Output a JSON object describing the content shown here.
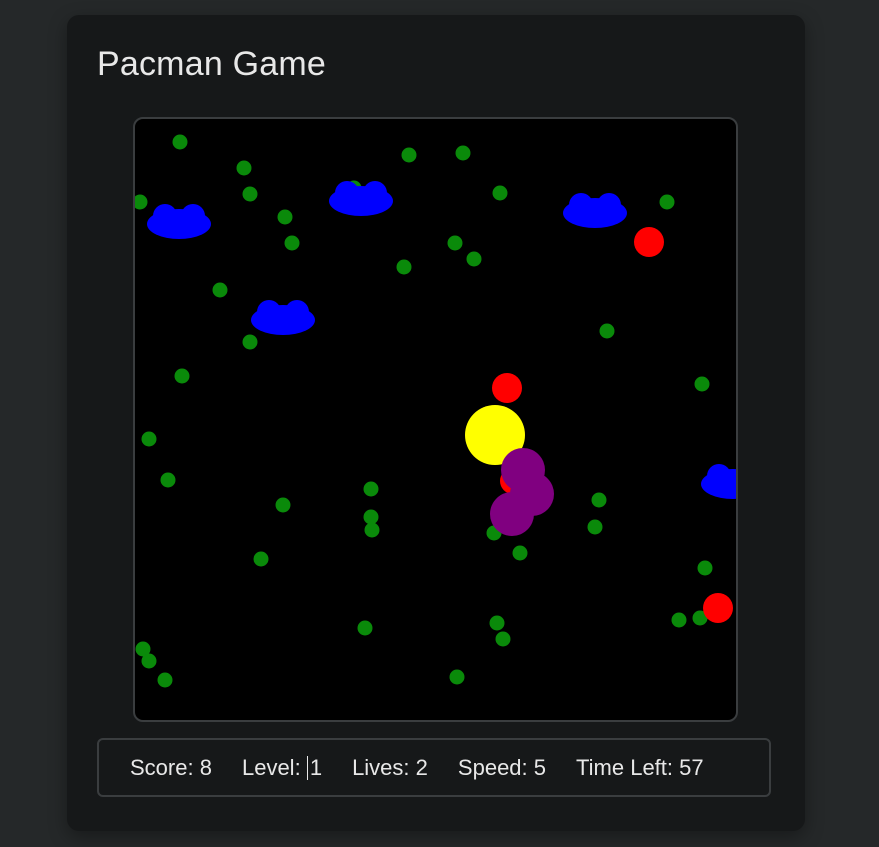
{
  "title": "Pacman Game",
  "colors": {
    "page_bg": "#252829",
    "card_bg": "#161819",
    "board_bg": "#000000",
    "pellet": "#0a8a0a",
    "ghost": "#0000ff",
    "power_up": "#ff0000",
    "pacman": "#ffff00",
    "enemy": "#800080"
  },
  "status": {
    "score_label": "Score:",
    "score": "8",
    "level_label": "Level:",
    "level": "1",
    "lives_label": "Lives:",
    "lives": "2",
    "speed_label": "Speed:",
    "speed": "5",
    "time_label": "Time Left:",
    "time": "57"
  },
  "board": {
    "pacman": {
      "icon": "pacman-icon"
    },
    "pellet_count": 46,
    "ghost_count": 5,
    "power_up_count": 4,
    "enemy_count": 3
  }
}
